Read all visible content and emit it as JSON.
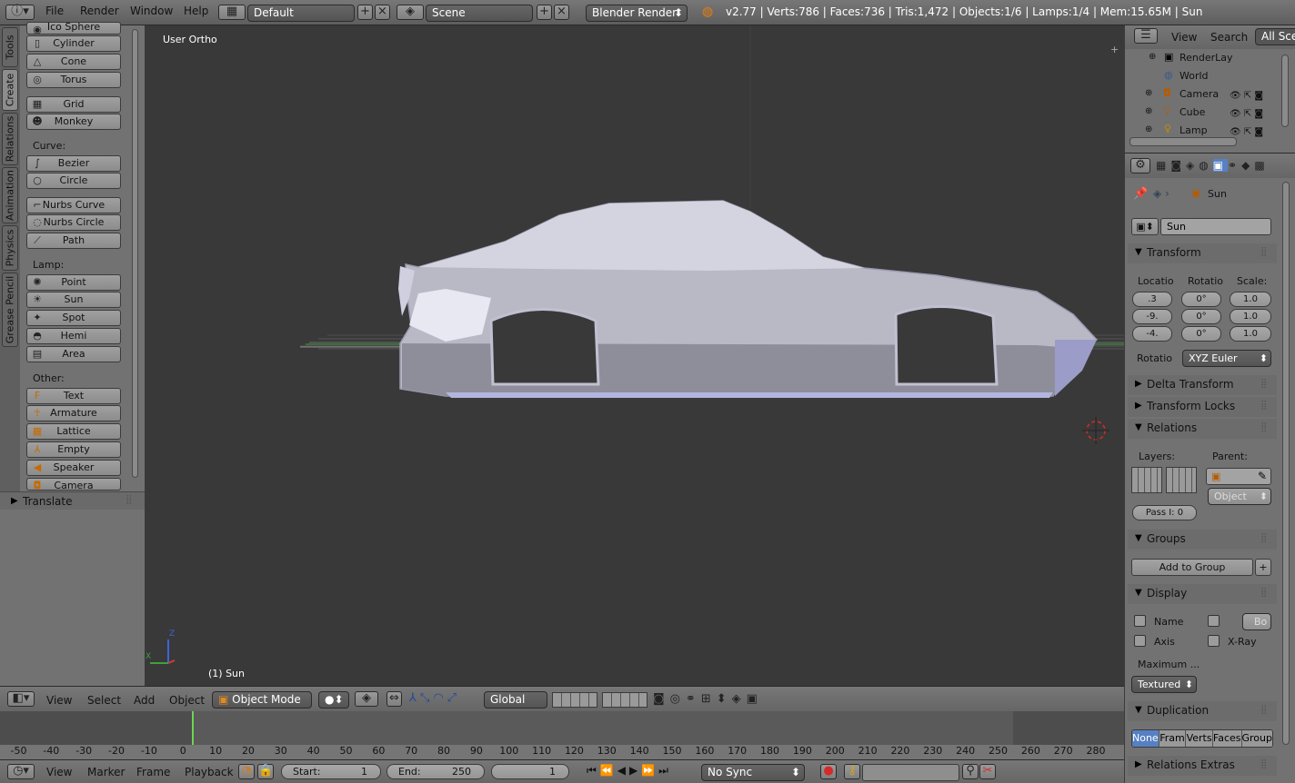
{
  "topbar": {
    "menus": [
      "File",
      "Render",
      "Window",
      "Help"
    ],
    "layout": "Default",
    "scene": "Scene",
    "engine": "Blender Render",
    "info": "v2.77 | Verts:786 | Faces:736 | Tris:1,472 | Objects:1/6 | Lamps:1/4 | Mem:15.65M | Sun"
  },
  "tools": {
    "tabs": [
      "Tools",
      "Create",
      "Relations",
      "Animation",
      "Physics",
      "Grease Pencil"
    ],
    "mesh_items": [
      "Ico Sphere",
      "Cylinder",
      "Cone",
      "Torus",
      "Grid",
      "Monkey"
    ],
    "curve_label": "Curve:",
    "curve_items": [
      "Bezier",
      "Circle",
      "Nurbs Curve",
      "Nurbs Circle",
      "Path"
    ],
    "lamp_label": "Lamp:",
    "lamp_items": [
      "Point",
      "Sun",
      "Spot",
      "Hemi",
      "Area"
    ],
    "other_label": "Other:",
    "other_items": [
      "Text",
      "Armature",
      "Lattice",
      "Empty",
      "Speaker",
      "Camera"
    ],
    "translate": "Translate"
  },
  "viewport": {
    "view_label": "User Ortho",
    "object_label": "(1) Sun",
    "axis_y": "Z",
    "axis_x": "X",
    "colors": {
      "background": "#393939",
      "car_body": "#c8c8d6",
      "grid_green": "#3f8f3f"
    }
  },
  "outliner": {
    "menu_view": "View",
    "menu_search": "Search",
    "scenes": "All Sce",
    "items": [
      "RenderLay",
      "World",
      "Camera",
      "Cube",
      "Lamp"
    ]
  },
  "properties": {
    "breadcrumb": "Sun",
    "object_name": "Sun",
    "transform": "Transform",
    "location_label": "Locatio",
    "rotation_label": "Rotatio",
    "scale_label": "Scale:",
    "location": [
      ".3",
      "-9.",
      "-4."
    ],
    "rotation": [
      "0°",
      "0°",
      "0°"
    ],
    "scale": [
      "1.0",
      "1.0",
      "1.0"
    ],
    "rotation_mode_label": "Rotatio",
    "rotation_mode": "XYZ Euler",
    "delta": "Delta Transform",
    "locks": "Transform Locks",
    "relations": "Relations",
    "layers_label": "Layers:",
    "parent_label": "Parent:",
    "parent_type": "Object",
    "pass_index": "Pass I: 0",
    "groups": "Groups",
    "add_to_group": "Add to Group",
    "display": "Display",
    "name_label": "Name",
    "axis_label": "Axis",
    "xray_label": "X-Ray",
    "bounds_label": "Bo",
    "maximum_label": "Maximum ...",
    "draw_type": "Textured",
    "duplication": "Duplication",
    "dup_options": [
      "None",
      "Fram",
      "Verts",
      "Faces",
      "Group"
    ],
    "relations_extras": "Relations Extras"
  },
  "vpheader": {
    "menus": [
      "View",
      "Select",
      "Add",
      "Object"
    ],
    "mode": "Object Mode",
    "orientation": "Global"
  },
  "timeline": {
    "ticks": [
      "-50",
      "-40",
      "-30",
      "-20",
      "-10",
      "0",
      "10",
      "20",
      "30",
      "40",
      "50",
      "60",
      "70",
      "80",
      "90",
      "100",
      "110",
      "120",
      "130",
      "140",
      "150",
      "160",
      "170",
      "180",
      "190",
      "200",
      "210",
      "220",
      "230",
      "240",
      "250",
      "260",
      "270",
      "280"
    ],
    "menus": [
      "View",
      "Marker",
      "Frame",
      "Playback"
    ],
    "start": "Start:",
    "start_val": "1",
    "end": "End:",
    "end_val": "250",
    "current": "1",
    "sync": "No Sync"
  }
}
